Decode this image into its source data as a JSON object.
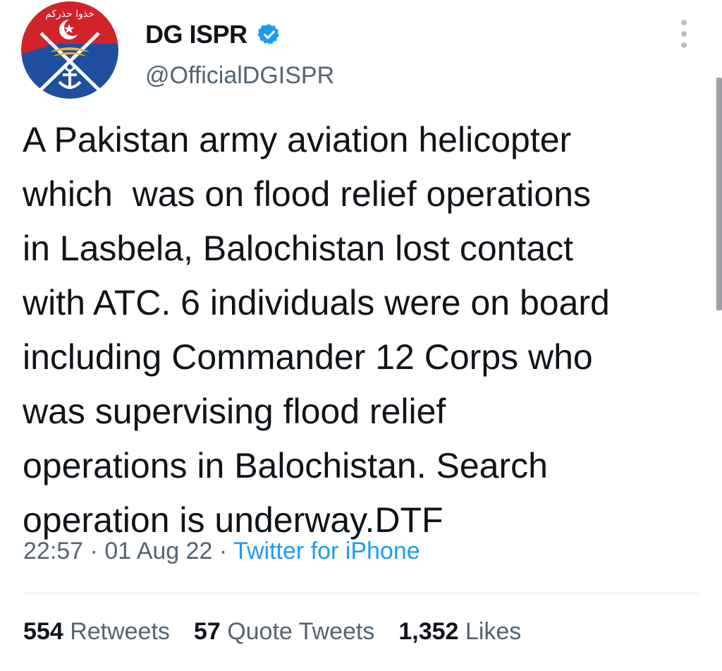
{
  "header": {
    "avatar_icon": "dg-ispr-emblem-avatar",
    "author_name": "DG ISPR",
    "verified_icon": "verified-badge-icon",
    "handle": "@OfficialDGISPR",
    "menu_icon": "more-options-icon",
    "emblem_text": "خذوا حذركم"
  },
  "tweet": {
    "lines": [
      "A Pakistan army aviation helicopter",
      "which  was on flood relief operations",
      "in Lasbela, Balochistan lost contact",
      "with ATC. 6 individuals were on board",
      "including Commander 12 Corps who",
      "was supervising flood relief",
      "operations in Balochistan. Search",
      "operation is underway.DTF"
    ]
  },
  "meta": {
    "time": "22:57",
    "sep1": " · ",
    "date": "01 Aug 22",
    "sep2": " · ",
    "source": "Twitter for iPhone"
  },
  "stats": {
    "retweets_count": "554",
    "retweets_label": "Retweets",
    "quotes_count": "57",
    "quotes_label": "Quote Tweets",
    "likes_count": "1,352",
    "likes_label": "Likes"
  },
  "colors": {
    "link": "#1d9bf0",
    "secondary_text": "#536471",
    "primary_text": "#0f1419",
    "emblem_red": "#d2232a",
    "emblem_blue": "#1f4e9e"
  }
}
